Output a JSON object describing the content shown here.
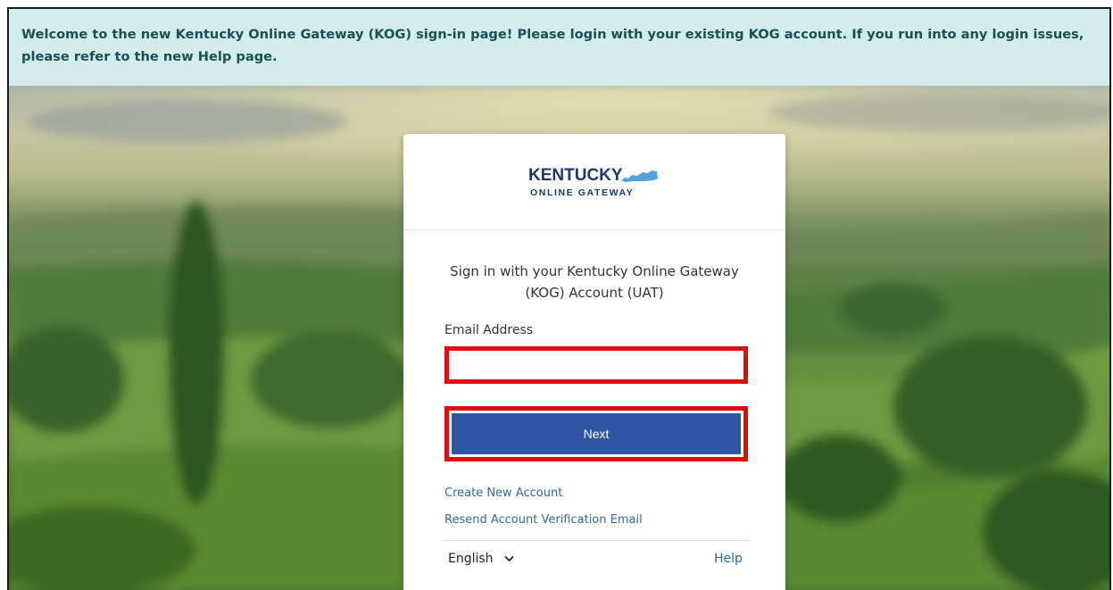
{
  "banner": {
    "text": "Welcome to the new Kentucky Online Gateway (KOG) sign-in page! Please login with your existing KOG account. If you run into any login issues, please refer to the new Help page."
  },
  "logo": {
    "line1": "KENTUCKY",
    "line2": "ONLINE GATEWAY",
    "state_icon": "kentucky-state-icon"
  },
  "signin": {
    "heading": "Sign in with your Kentucky Online Gateway (KOG) Account (UAT)",
    "email_label": "Email Address",
    "email_value": "",
    "email_placeholder": "",
    "next_label": "Next",
    "create_account": "Create New Account",
    "resend_verification": "Resend Account Verification Email"
  },
  "footer": {
    "language": "English",
    "language_icon": "chevron-down-icon",
    "help": "Help"
  },
  "colors": {
    "banner_bg": "#d3ecee",
    "banner_text": "#1b4f52",
    "primary_button": "#2e56a3",
    "link": "#2e6aa3",
    "highlight_border": "#e20c0c",
    "logo_navy": "#1b3a6b",
    "logo_blue": "#4fa3e0"
  }
}
